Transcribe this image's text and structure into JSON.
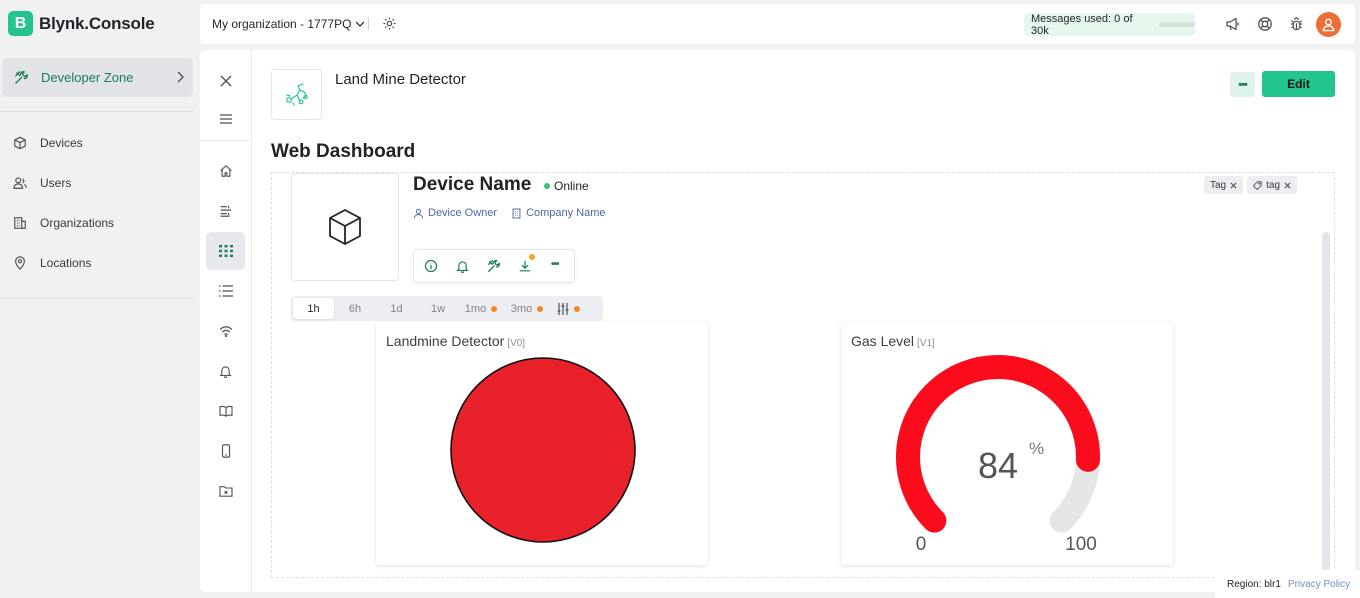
{
  "app": {
    "brand_letter": "B",
    "brand_name": "Blynk.Console"
  },
  "sidebar": {
    "developer_zone": "Developer Zone",
    "items": [
      {
        "label": "Devices",
        "icon": "cube-icon"
      },
      {
        "label": "Users",
        "icon": "users-icon"
      },
      {
        "label": "Organizations",
        "icon": "building-icon"
      },
      {
        "label": "Locations",
        "icon": "location-pin-icon"
      }
    ]
  },
  "header": {
    "organization": "My organization - 1777PQ",
    "messages_label": "Messages used:",
    "messages_value": "0 of 30k",
    "messages_used_fraction": 0.0
  },
  "template": {
    "name": "Land Mine Detector",
    "edit_label": "Edit",
    "more_label": "•••"
  },
  "dashboard": {
    "title": "Web Dashboard",
    "device_name": "Device Name",
    "status": "Online",
    "owner": "Device Owner",
    "company": "Company Name",
    "tags": [
      "Tag",
      "tag"
    ],
    "time_ranges": [
      {
        "label": "1h",
        "active": true,
        "dot": false
      },
      {
        "label": "6h",
        "active": false,
        "dot": false
      },
      {
        "label": "1d",
        "active": false,
        "dot": false
      },
      {
        "label": "1w",
        "active": false,
        "dot": false
      },
      {
        "label": "1mo",
        "active": false,
        "dot": true
      },
      {
        "label": "3mo",
        "active": false,
        "dot": true
      }
    ]
  },
  "widgets": {
    "led": {
      "title": "Landmine Detector",
      "pin": "[V0]",
      "color": "#e8212b"
    },
    "gauge": {
      "title": "Gas Level",
      "pin": "[V1]",
      "value": "84",
      "unit": "%",
      "min": "0",
      "max": "100",
      "color": "#fa0c1c",
      "track_color": "#e6e6e6"
    }
  },
  "footer": {
    "region": "Region: blr1",
    "privacy": "Privacy Policy"
  },
  "colors": {
    "accent": "#23c48e",
    "online": "#3ec46d",
    "notification": "#f5a524"
  }
}
